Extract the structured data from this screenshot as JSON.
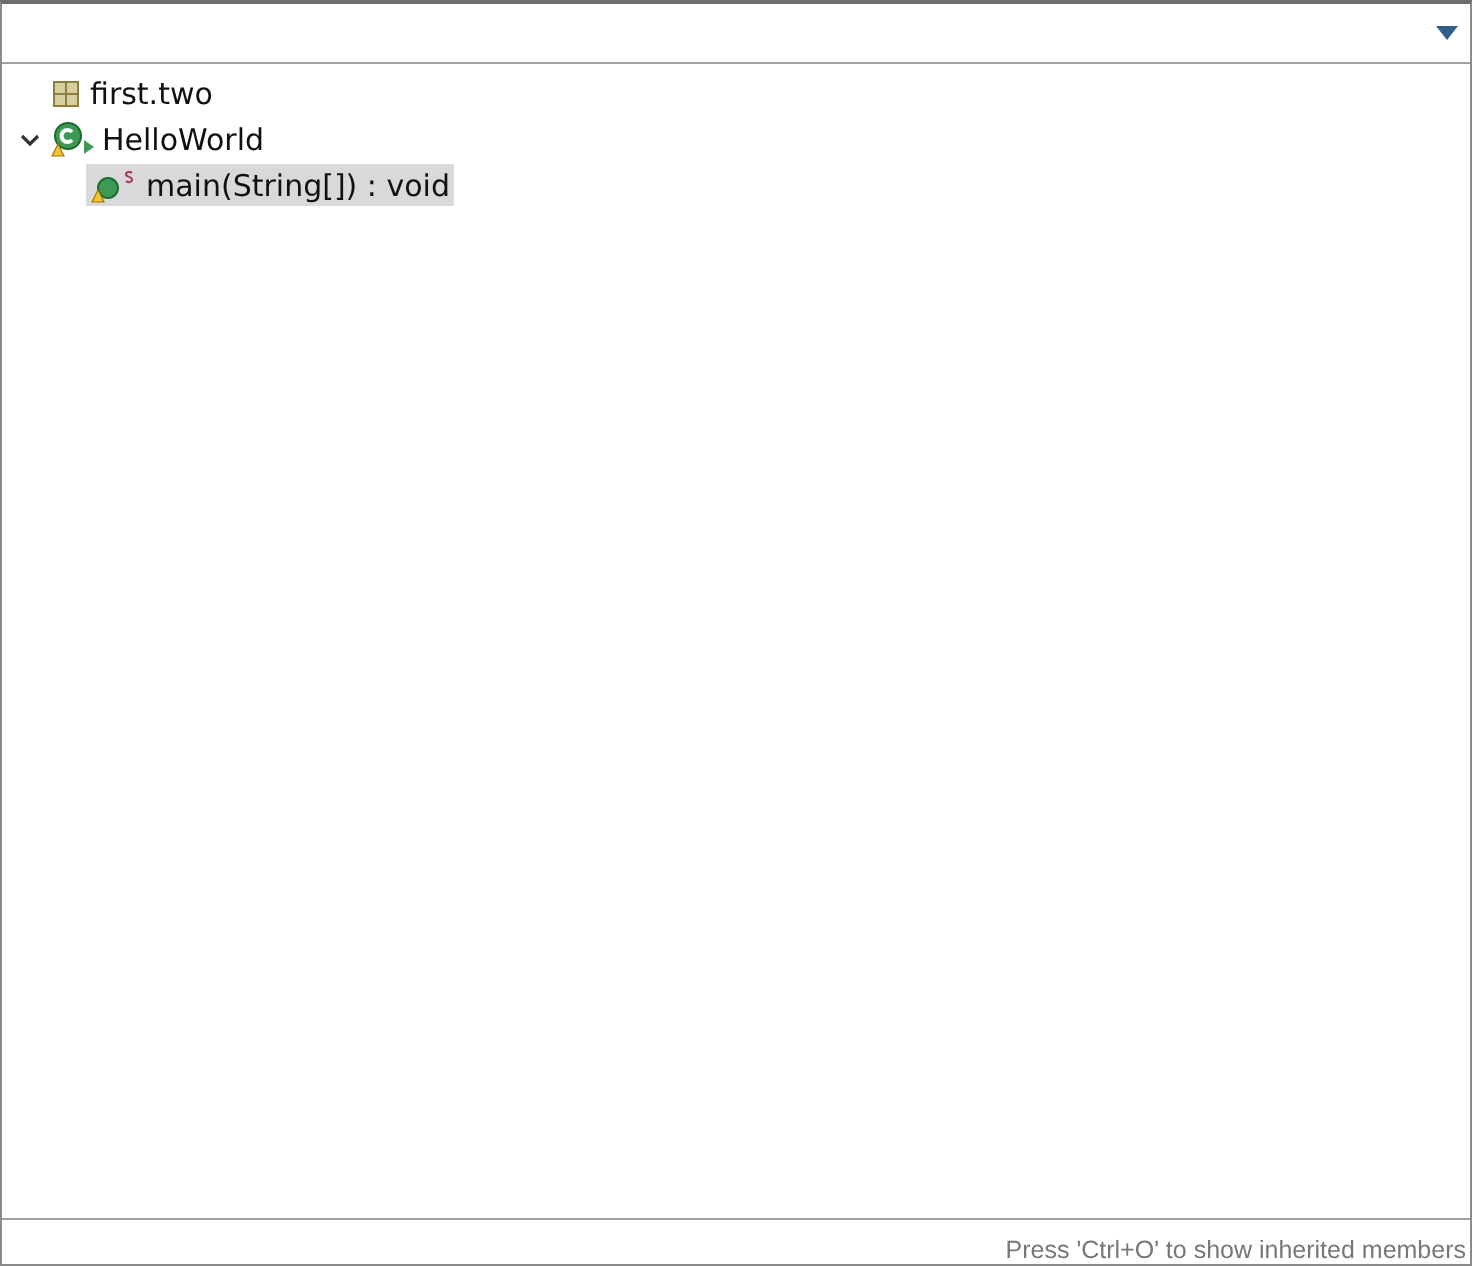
{
  "tree": [
    {
      "kind": "package",
      "label": "first.two",
      "selected": false
    },
    {
      "kind": "class",
      "label": "HelloWorld",
      "expanded": true,
      "selected": false,
      "children": [
        {
          "kind": "method",
          "label": "main(String[]) : void",
          "selected": true
        }
      ]
    }
  ],
  "status_bar": {
    "hint": "Press 'Ctrl+O' to show inherited members"
  }
}
